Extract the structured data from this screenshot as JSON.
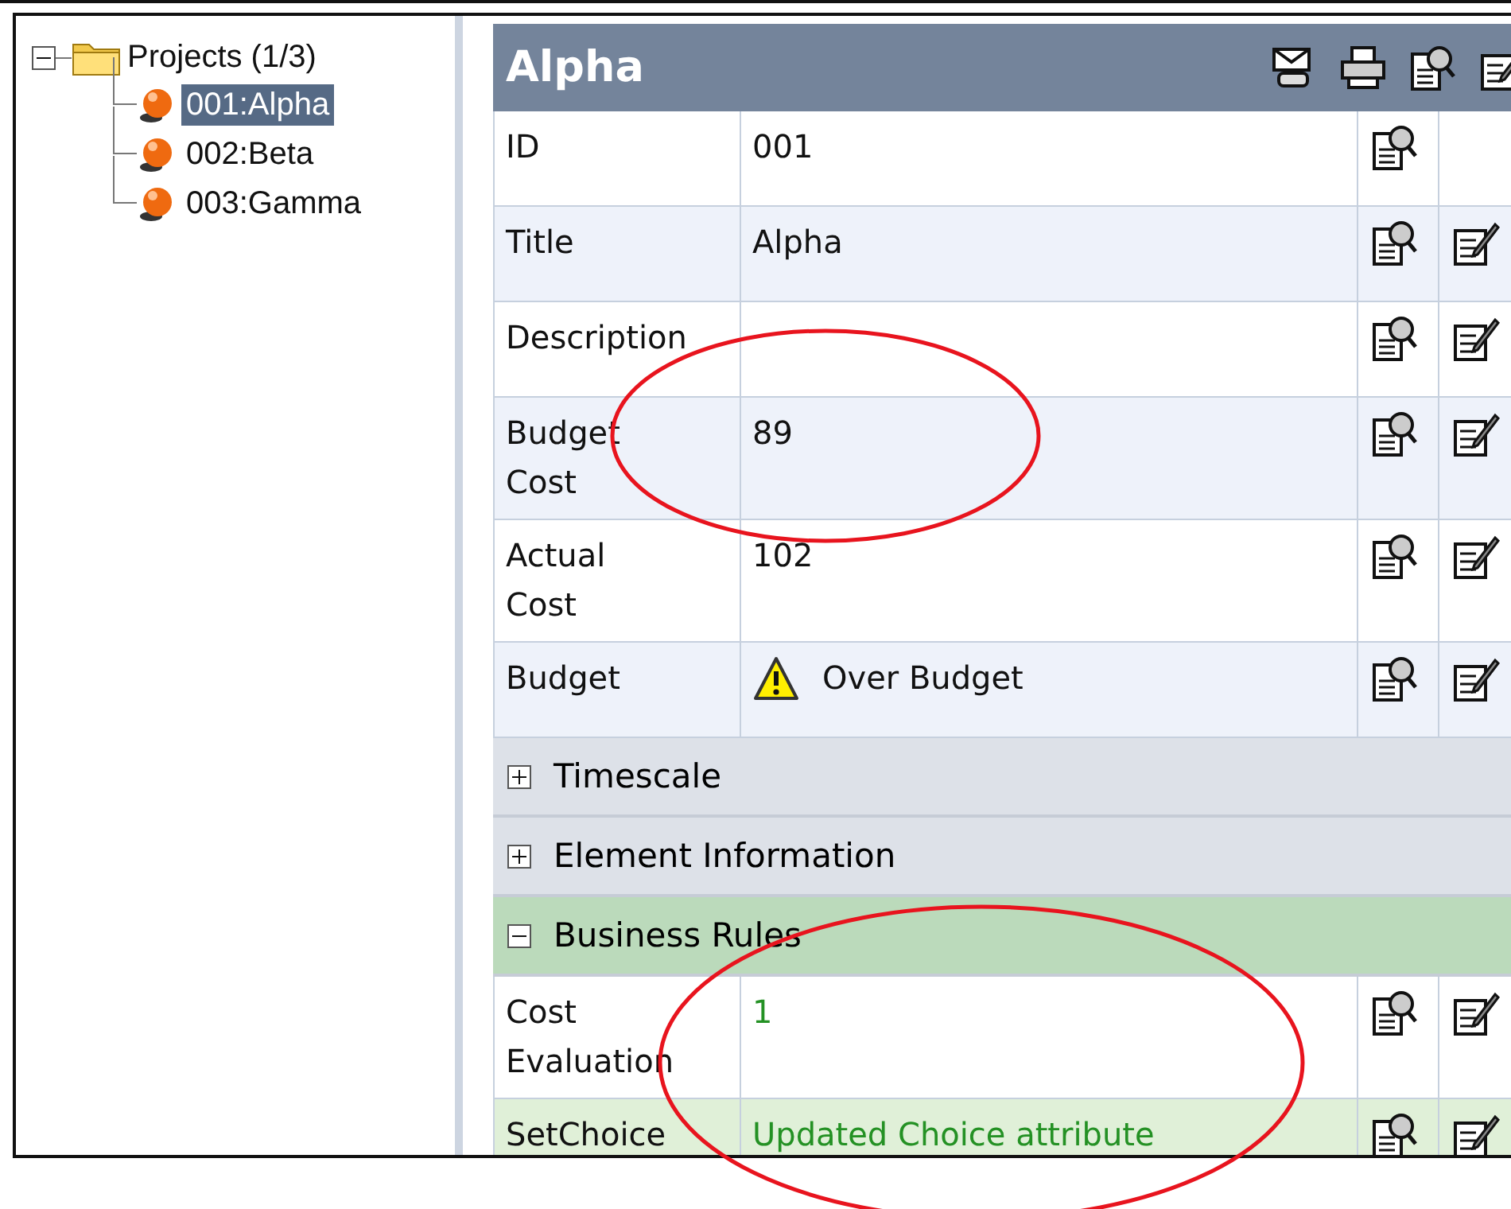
{
  "tree": {
    "label": "Projects (1/3)",
    "expanded": true,
    "children": [
      {
        "label": "001:Alpha",
        "selected": true
      },
      {
        "label": "002:Beta",
        "selected": false
      },
      {
        "label": "003:Gamma",
        "selected": false
      }
    ]
  },
  "details": {
    "title": "Alpha",
    "fields": [
      {
        "label": "ID",
        "value": "001",
        "editable": false
      },
      {
        "label": "Title",
        "value": "Alpha",
        "editable": true
      },
      {
        "label": "Description",
        "editable": true
      },
      {
        "label": "Budget\nCost",
        "value": "89",
        "editable": true
      },
      {
        "label": "Actual\nCost",
        "value": "102",
        "editable": true
      },
      {
        "label": "Budget",
        "value": "Over Budget",
        "warning": true,
        "editable": true
      }
    ],
    "sections": [
      {
        "title": "Timescale",
        "expanded": false,
        "kind": "plain"
      },
      {
        "title": "Element Information",
        "expanded": false,
        "kind": "plain"
      },
      {
        "title": "Business Rules",
        "expanded": true,
        "kind": "rules",
        "fields": [
          {
            "label": "Cost\nEvaluation",
            "value": "1",
            "editable": true
          },
          {
            "label": "SetChoice",
            "value": "Updated Choice attribute",
            "editable": true
          }
        ]
      }
    ]
  },
  "annotations": [
    {
      "kind": "ellipse"
    },
    {
      "kind": "ellipse"
    }
  ]
}
